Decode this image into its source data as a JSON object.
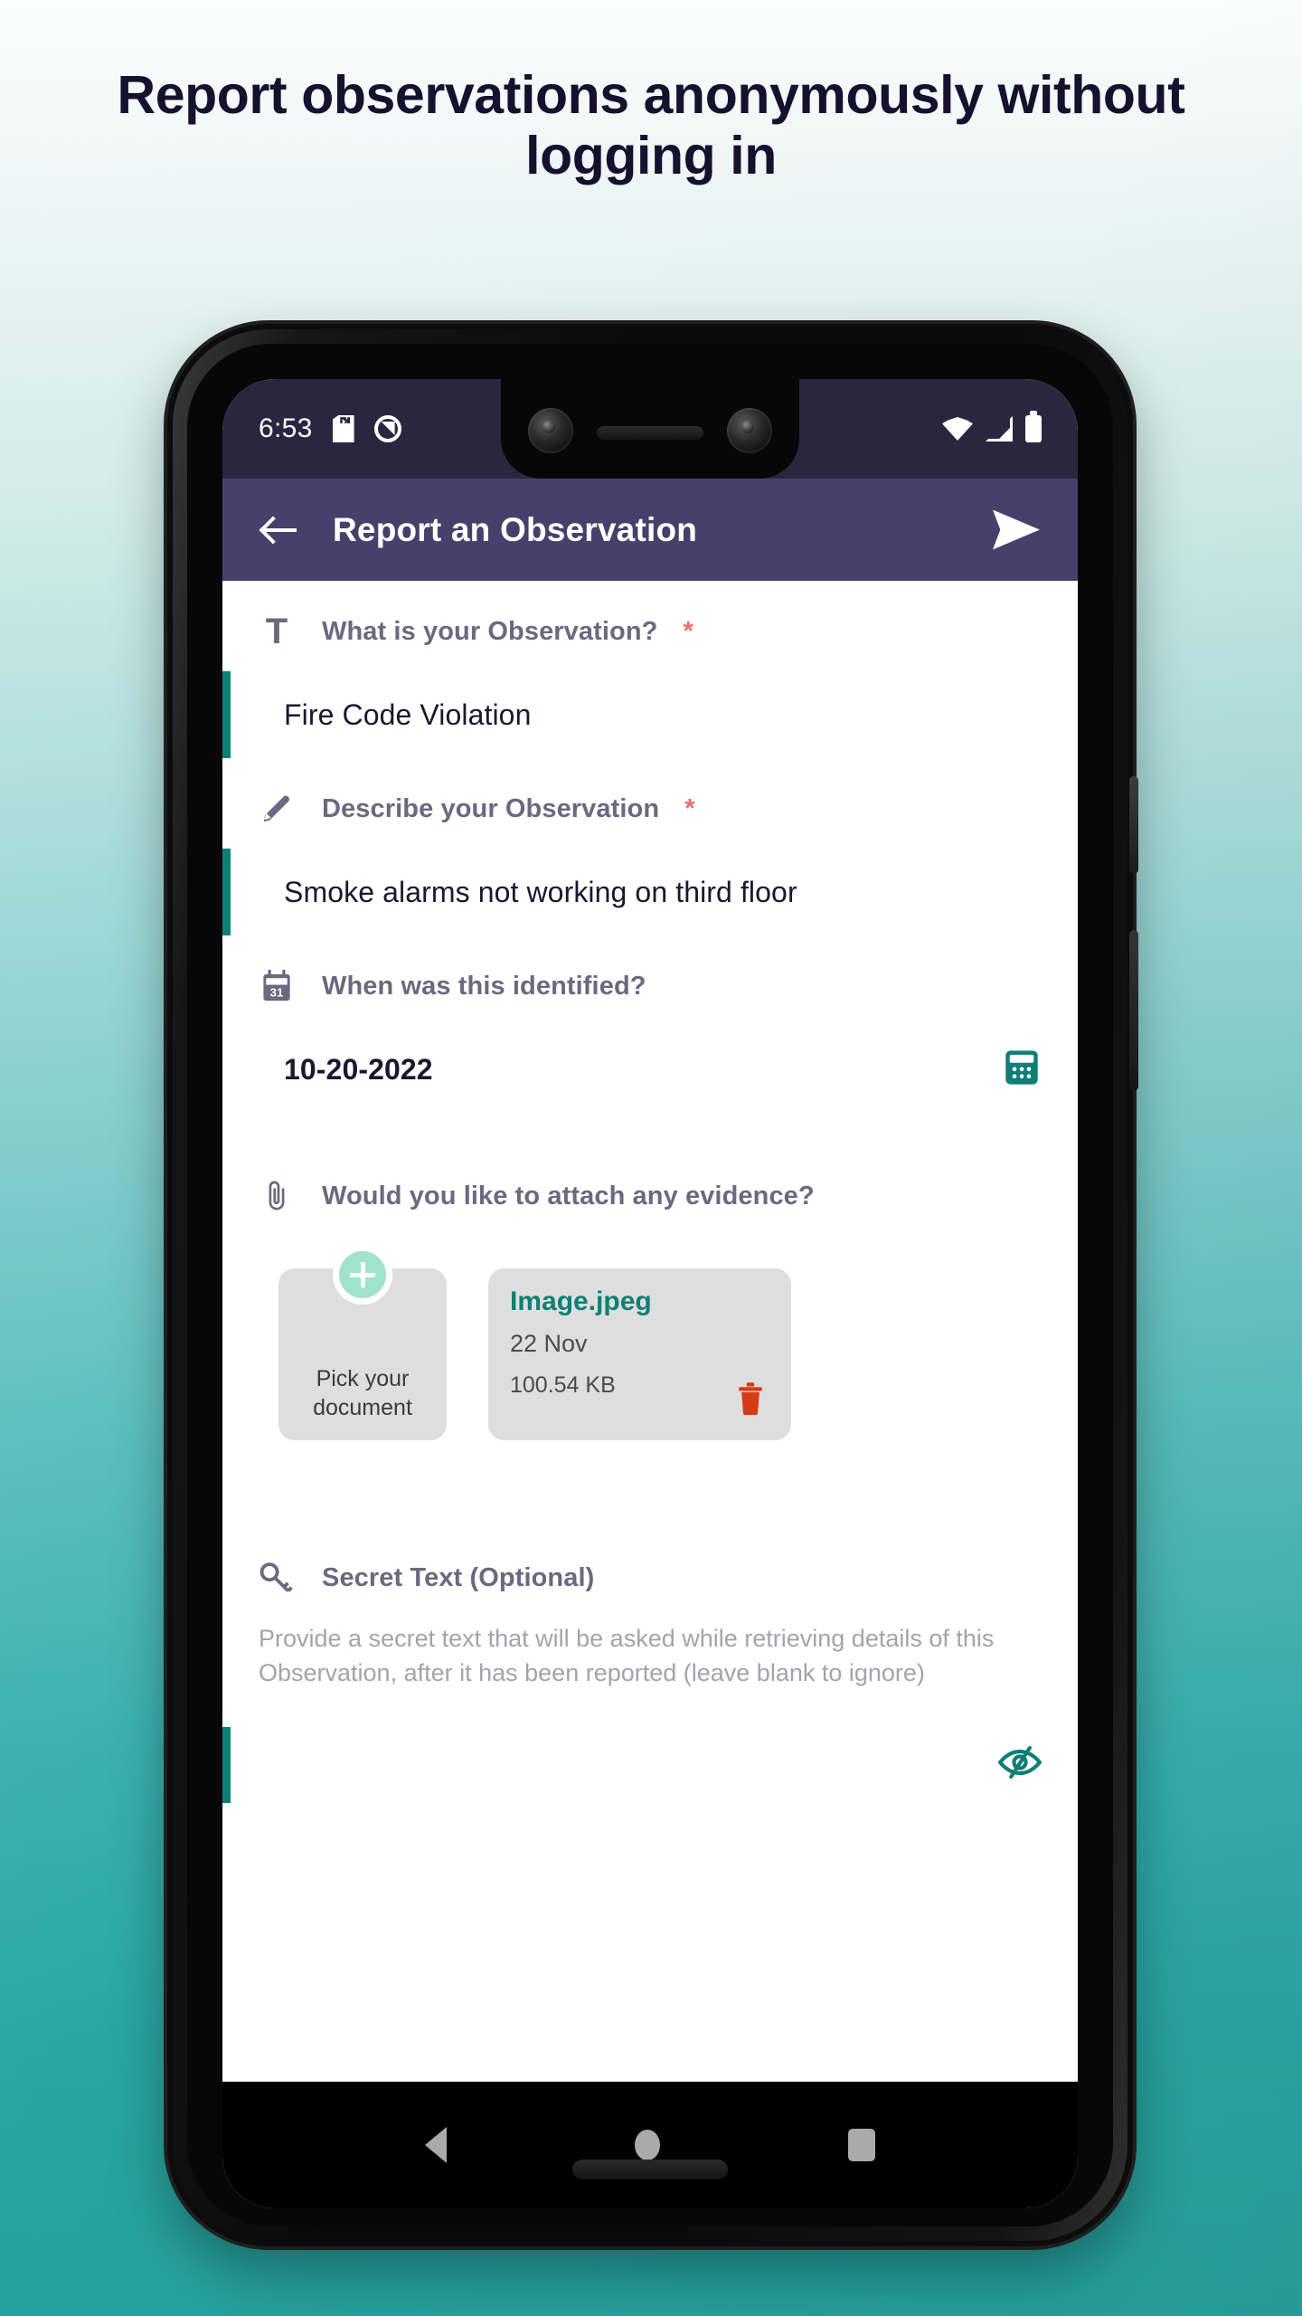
{
  "headline": "Report observations anonymously without logging in",
  "colors": {
    "headline_text": "#15112e",
    "bg_top": "#fbfdfc",
    "bg_bottom": "#26a29e",
    "statusbar_bg": "#2b2640",
    "appbar_bg": "#47406b",
    "accent_teal": "#0d7f75",
    "required_red": "#ef6b6b",
    "mint": "#9fe3cd",
    "trash_red": "#d63b14",
    "card_grey": "#dedede",
    "label_grey": "#6b6880",
    "placeholder_grey": "#a3a3ad"
  },
  "status_bar": {
    "time": "6:53",
    "icons_left": [
      "sd-card-icon",
      "do-not-disturb-icon"
    ],
    "icons_right": [
      "wifi-icon",
      "cellular-signal-icon",
      "battery-icon"
    ]
  },
  "app_bar": {
    "back_icon": "back-arrow-icon",
    "title": "Report an Observation",
    "send_icon": "send-icon"
  },
  "form": {
    "observation": {
      "icon": "text-format-icon",
      "label": "What is your Observation?",
      "required_marker": "*",
      "value": "Fire Code Violation"
    },
    "describe": {
      "icon": "pencil-icon",
      "label": "Describe your Observation",
      "required_marker": "*",
      "value": "Smoke alarms not working on third floor"
    },
    "date": {
      "icon": "calendar-31-icon",
      "label": "When was this identified?",
      "value": "10-20-2022",
      "picker_icon": "calendar-picker-icon"
    },
    "evidence": {
      "icon": "paperclip-icon",
      "label": "Would you like to attach any evidence?",
      "pick_card": {
        "badge_icon": "plus-icon",
        "label_line1": "Pick your",
        "label_line2": "document"
      },
      "files": [
        {
          "name": "Image.jpeg",
          "date": "22 Nov",
          "size": "100.54 KB",
          "delete_icon": "trash-icon"
        }
      ]
    },
    "secret": {
      "icon": "key-icon",
      "label": "Secret Text (Optional)",
      "description": "Provide a secret text that will be asked while retrieving details of this Observation, after it has been reported (leave blank to ignore)",
      "value": "",
      "visibility_icon": "eye-off-icon"
    }
  },
  "nav_bar": {
    "back": "nav-back-icon",
    "home": "nav-home-icon",
    "recents": "nav-recents-icon"
  }
}
